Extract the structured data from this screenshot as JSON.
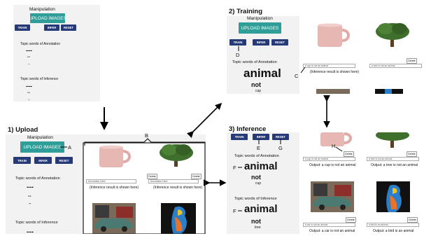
{
  "upload_panel": {
    "title": "1) Upload",
    "manipulation_label": "Manipulation",
    "upload_button": "UPLOAD IMAGES",
    "train_button": "TRAIN",
    "infer_button": "INFER",
    "reset_button": "RESET",
    "annotation_topic_label": "Topic words of Annotation",
    "inference_topic_label": "Topic words of Inference",
    "placeholder_dash_1": "---",
    "placeholder_dash_2": "--",
    "placeholder_dash_3": "--",
    "placeholder_dash_4": "---",
    "annotation_field": "Annotation Here",
    "inference_placeholder": "(Inference result is shown here)",
    "delete_label": "Delete",
    "label_A": "A",
    "label_B": "B"
  },
  "preview_panel": {
    "upload_button": "UPLOAD IMAGES",
    "train_button": "TRAIN",
    "infer_button": "INFER",
    "reset_button": "RESET",
    "manipulation_label": "Manipulation",
    "annotation_topic_label": "Topic words of Annotation",
    "inference_topic_label": "Topic words of Inference",
    "dash_1": "---",
    "dash_2": "--",
    "dash_3": "--",
    "dash_4": "---",
    "dash_5": "--",
    "dash_6": "--"
  },
  "training_panel": {
    "title": "2) Training",
    "manipulation_label": "Manipulation",
    "upload_button": "UPLOAD IMAGES",
    "train_button": "TRAIN",
    "infer_button": "INFER",
    "reset_button": "RESET",
    "annotation_topic_label": "Topic words of Annotation",
    "word_big": "animal",
    "word_mid": "not",
    "word_small": "cup",
    "field_cup": "a cup is not an animal",
    "field_tree": "a tree is not an animal",
    "inference_placeholder": "(Inference result is shown here)",
    "delete_label": "Delete",
    "label_C": "C",
    "label_D": "D"
  },
  "inference_panel": {
    "title": "3) Inference",
    "train_button": "TRAIN",
    "infer_button": "INFER",
    "reset_button": "RESET",
    "annotation_topic_label": "Topic words of Annotation",
    "inference_topic_label": "Topic words of Inference",
    "ann_word_big": "animal",
    "ann_word_mid": "not",
    "ann_word_small": "cup",
    "inf_word_big": "animal",
    "inf_word_mid": "not",
    "inf_word_small": "tree",
    "field_cup": "a cup is not an animal",
    "field_tree": "a tree is not an animal",
    "field_car": "a car is not an animal",
    "field_bird": "a bird is an animal",
    "output_cup": "Output: a cup is not an animal",
    "output_tree": "Output: a tree is not an animal",
    "output_car": "Output: a car is not an animal",
    "output_bird": "Output: a bird is an animal",
    "delete_label": "Delete",
    "label_E": "E",
    "label_G": "G",
    "label_H": "H",
    "label_F1": "F",
    "label_F2": "F"
  }
}
